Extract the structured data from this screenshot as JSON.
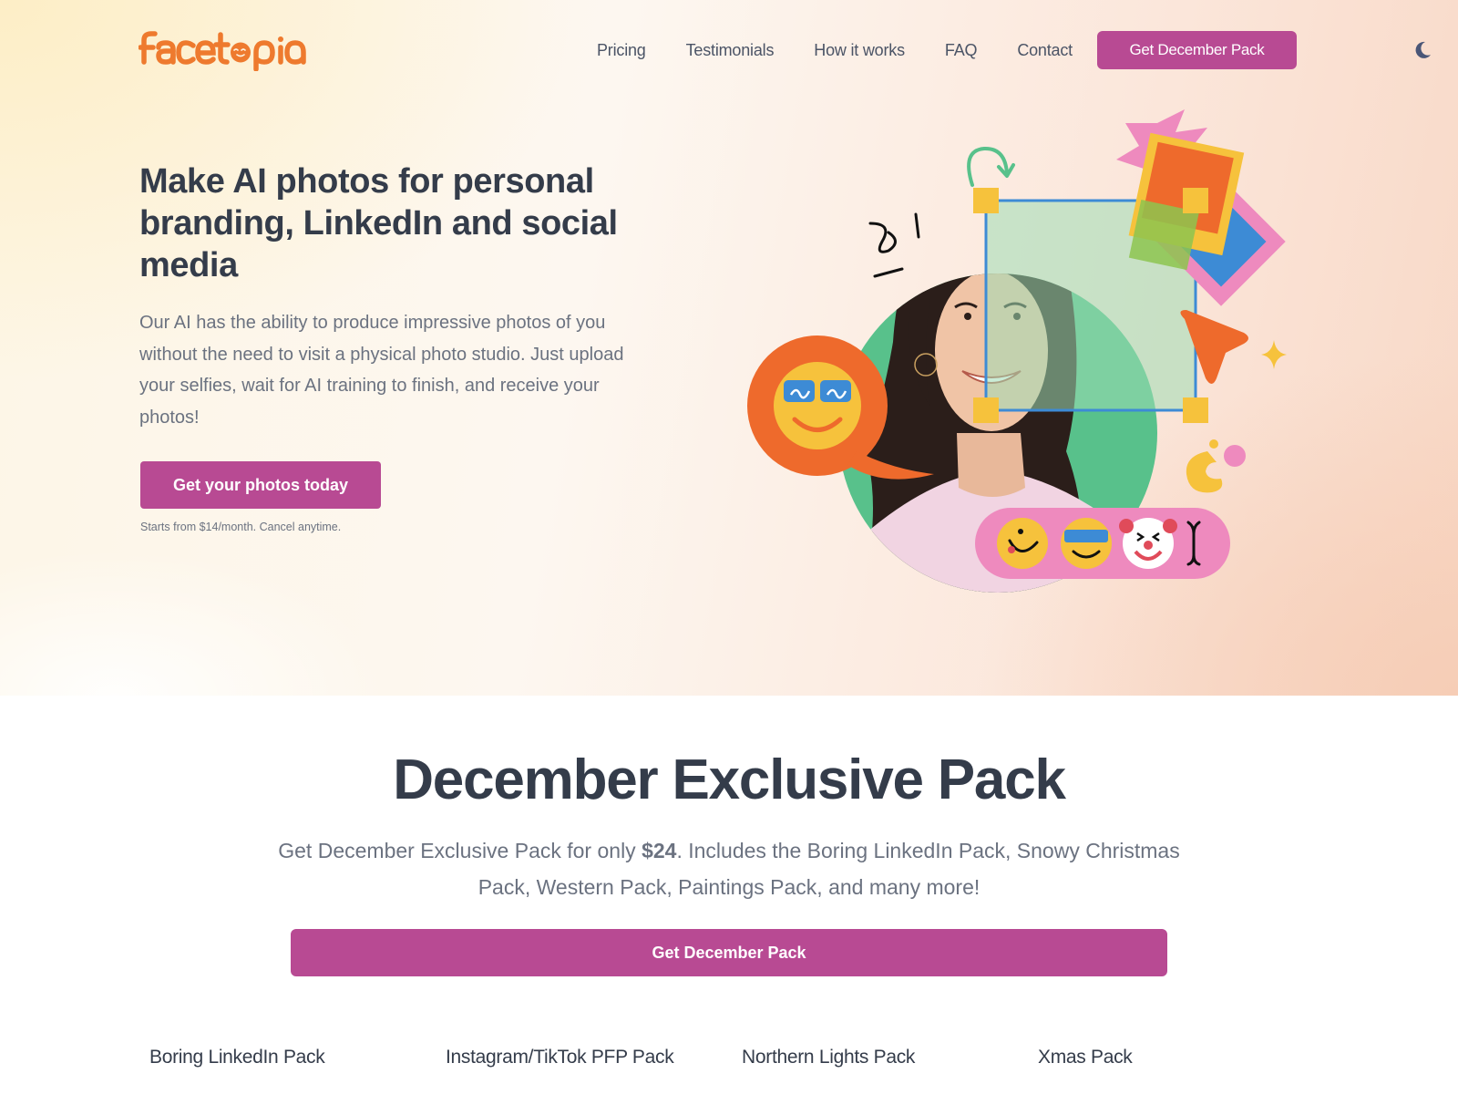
{
  "brand": {
    "name": "facetopia",
    "logo_color": "#ee7a2e",
    "accent": "#b84a93",
    "text_dark": "#343c4a",
    "text_muted": "#6b7280"
  },
  "nav": {
    "links": [
      "Pricing",
      "Testimonials",
      "How it works",
      "FAQ",
      "Contact"
    ],
    "cta_label": "Get December Pack",
    "theme_toggle_icon": "moon-icon"
  },
  "hero": {
    "title": "Make AI photos for personal branding, LinkedIn and social media",
    "description": "Our AI has the ability to produce impressive photos of you without the need to visit a physical photo studio. Just upload your selfies, wait for AI training to finish, and receive your photos!",
    "cta_label": "Get your photos today",
    "note": "Starts from $14/month. Cancel anytime.",
    "illustration": {
      "description": "Smiling woman in a green circle with a selection box, emoji speech bubble, and colorful sticker shapes",
      "emoji_bar": [
        "tongue-out-smile-emoji",
        "sunglasses-smile-emoji",
        "clown-emoji"
      ]
    }
  },
  "december": {
    "title": "December Exclusive Pack",
    "desc_before": "Get December Exclusive Pack for only ",
    "price": "$24",
    "desc_after": ". Includes the Boring LinkedIn Pack, Snowy Christmas Pack, Western Pack, Paintings Pack, and many more!",
    "cta_label": "Get December Pack"
  },
  "packs": [
    {
      "title": "Boring LinkedIn Pack"
    },
    {
      "title": "Instagram/TikTok PFP Pack"
    },
    {
      "title": "Northern Lights Pack"
    },
    {
      "title": "Xmas Pack"
    }
  ]
}
